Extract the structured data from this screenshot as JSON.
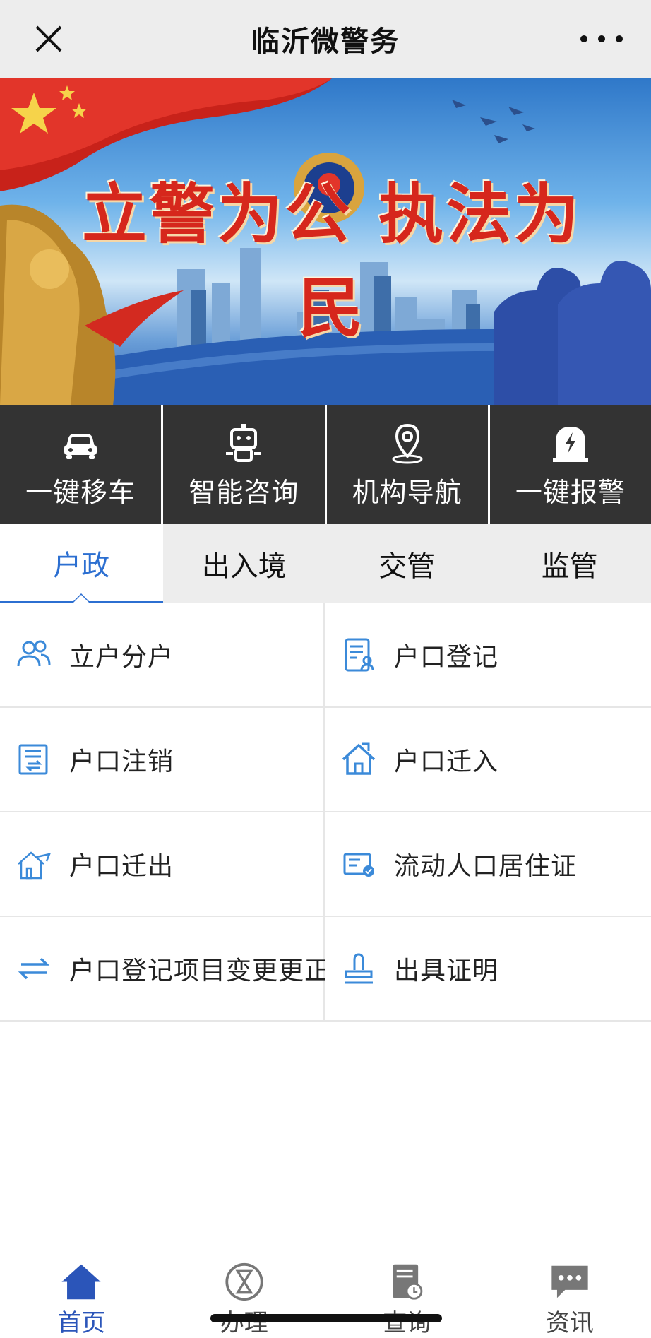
{
  "header": {
    "title": "临沂微警务",
    "close_icon": "close-icon",
    "more_icon": "more-dots-icon"
  },
  "banner": {
    "slogan": "立警为公 执法为民",
    "image": "police-banner-image"
  },
  "quick_actions": [
    {
      "label": "一键移车",
      "icon": "car-icon"
    },
    {
      "label": "智能咨询",
      "icon": "robot-icon"
    },
    {
      "label": "机构导航",
      "icon": "location-pin-icon"
    },
    {
      "label": "一键报警",
      "icon": "alarm-icon"
    }
  ],
  "tabs": [
    {
      "label": "户政",
      "active": true
    },
    {
      "label": "出入境",
      "active": false
    },
    {
      "label": "交管",
      "active": false
    },
    {
      "label": "监管",
      "active": false
    }
  ],
  "services": [
    {
      "label": "立户分户",
      "icon": "people-icon"
    },
    {
      "label": "户口登记",
      "icon": "register-document-icon"
    },
    {
      "label": "户口注销",
      "icon": "cancel-document-icon"
    },
    {
      "label": "户口迁入",
      "icon": "house-in-icon"
    },
    {
      "label": "户口迁出",
      "icon": "house-out-icon"
    },
    {
      "label": "流动人口居住证",
      "icon": "residence-card-icon"
    },
    {
      "label": "户口登记项目变更更正",
      "icon": "swap-arrows-icon"
    },
    {
      "label": "出具证明",
      "icon": "stamp-icon"
    }
  ],
  "bottom_nav": [
    {
      "label": "首页",
      "icon": "home-icon",
      "active": true
    },
    {
      "label": "办理",
      "icon": "hourglass-icon",
      "active": false
    },
    {
      "label": "查询",
      "icon": "search-document-icon",
      "active": false
    },
    {
      "label": "资讯",
      "icon": "chat-bubble-icon",
      "active": false
    }
  ],
  "colors": {
    "accent": "#2c6fd1",
    "icon_blue": "#3b8ad9",
    "quick_bg": "#333333",
    "tab_bg": "#ededed"
  }
}
